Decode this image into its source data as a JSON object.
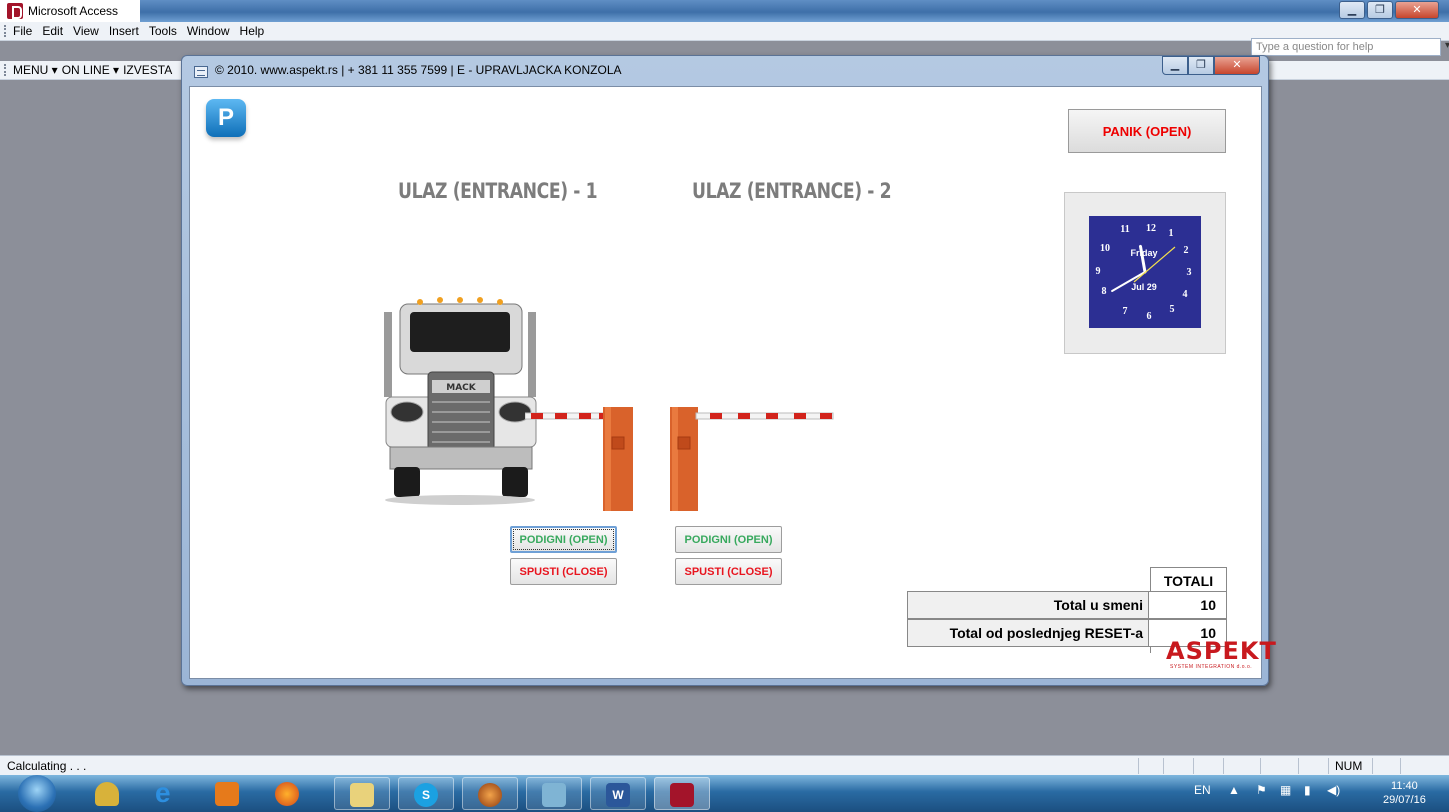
{
  "app": {
    "title": "Microsoft Access"
  },
  "menu": {
    "items": [
      "File",
      "Edit",
      "View",
      "Insert",
      "Tools",
      "Window",
      "Help"
    ]
  },
  "toolbar": {
    "items": [
      "MENU ▾",
      "ON LINE ▾",
      "IZVESTA"
    ]
  },
  "help": {
    "placeholder": "Type a question for help"
  },
  "child": {
    "title": "© 2010. www.aspekt.rs | + 381 11 355 7599 | E - UPRAVLJACKA KONZOLA"
  },
  "form": {
    "logo_letter": "P",
    "entrance1": "ULAZ (ENTRANCE) - 1",
    "entrance2": "ULAZ (ENTRANCE) - 2",
    "panic_button": "PANIK (OPEN)",
    "clock": {
      "numbers": [
        "12",
        "1",
        "2",
        "3",
        "4",
        "5",
        "6",
        "7",
        "8",
        "9",
        "10",
        "11"
      ],
      "day": "Friday",
      "date": "Jul 29",
      "hour": 11,
      "minute": 40
    },
    "truck_brand": "MACK",
    "gate1": {
      "open": "PODIGNI (OPEN)",
      "close": "SPUSTI (CLOSE)"
    },
    "gate2": {
      "open": "PODIGNI (OPEN)",
      "close": "SPUSTI (CLOSE)"
    },
    "totals": {
      "header": "TOTALI",
      "rows": [
        {
          "label": "Total u smeni",
          "value": "10"
        },
        {
          "label": "Total od poslednjeg RESET-a",
          "value": "10"
        }
      ]
    },
    "brand": "ASPEKT",
    "brand_sub": "SYSTEM INTEGRATION d.o.o."
  },
  "status": {
    "text": "Calculating . . .",
    "num": "NUM"
  },
  "taskbar": {
    "lang": "EN",
    "time": "11:40",
    "date": "29/07/16",
    "icons": [
      "start-orb",
      "keys-icon",
      "internet-explorer-icon",
      "media-player-icon",
      "firefox-icon",
      "file-explorer-icon",
      "skype-icon",
      "app-icon",
      "network-icon",
      "word-icon",
      "access-icon"
    ]
  },
  "colors": {
    "panic": "#e00000",
    "open": "#38a95e",
    "close": "#e8141e",
    "clock_face": "#2c2f93",
    "brand": "#c8191e"
  }
}
